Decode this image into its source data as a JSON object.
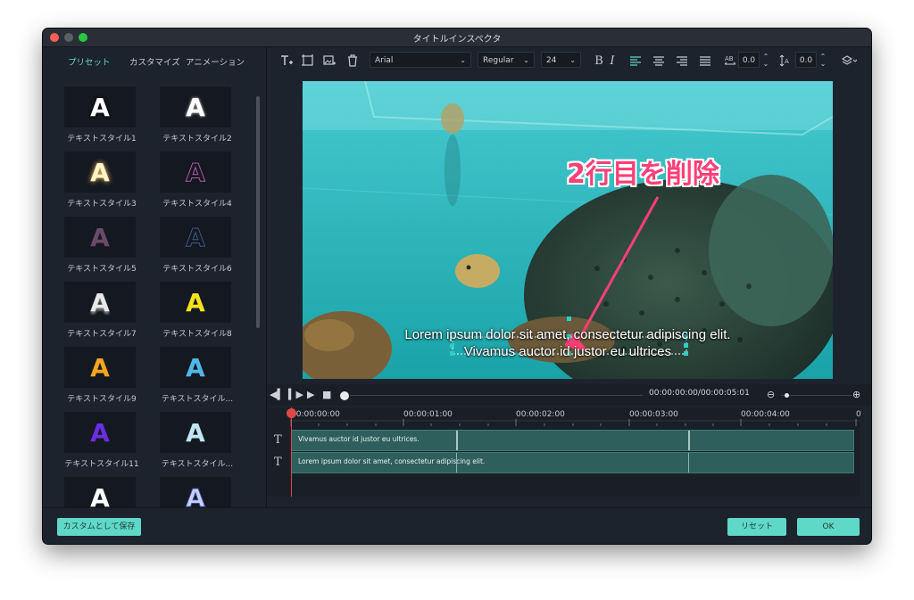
{
  "window": {
    "title": "タイトルインスペクタ"
  },
  "sidebar": {
    "tabs": [
      {
        "label": "プリセット",
        "active": true
      },
      {
        "label": "カスタマイズ",
        "active": false
      },
      {
        "label": "アニメーション",
        "active": false
      }
    ],
    "presets": [
      {
        "label": "テキストスタイル1",
        "glyph": "A",
        "color": "#ffffff"
      },
      {
        "label": "テキストスタイル2",
        "glyph": "A",
        "color": "#ffffff"
      },
      {
        "label": "テキストスタイル3",
        "glyph": "A",
        "color": "#fff3c8"
      },
      {
        "label": "テキストスタイル4",
        "glyph": "A",
        "color": "#b05aa8"
      },
      {
        "label": "テキストスタイル5",
        "glyph": "A",
        "color": "#6a4a6a"
      },
      {
        "label": "テキストスタイル6",
        "glyph": "A",
        "color": "#2a3f62"
      },
      {
        "label": "テキストスタイル7",
        "glyph": "A",
        "color": "#e8e8e8"
      },
      {
        "label": "テキストスタイル8",
        "glyph": "A",
        "color": "#f5e21c"
      },
      {
        "label": "テキストスタイル9",
        "glyph": "A",
        "color": "#f5a41e"
      },
      {
        "label": "テキストスタイル...",
        "glyph": "A",
        "color": "#4db8e8"
      },
      {
        "label": "テキストスタイル11",
        "glyph": "A",
        "color": "#6a2de0"
      },
      {
        "label": "テキストスタイル...",
        "glyph": "A",
        "color": "#bfe6f5"
      },
      {
        "label": "",
        "glyph": "A",
        "color": "#ffffff"
      },
      {
        "label": "",
        "glyph": "A",
        "color": "#c8d2f0"
      }
    ],
    "save_custom_label": "カスタムとして保存"
  },
  "toolbar": {
    "font": "Arial",
    "style": "Regular",
    "size": "24",
    "bold": "B",
    "italic": "I",
    "char_spacing": "0.0",
    "line_spacing": "0.0"
  },
  "preview": {
    "subtitle_line1": "Lorem ipsum dolor sit amet, consectetur adipiscing elit.",
    "subtitle_line2": "Vivamus auctor id justor eu ultrices",
    "annotation": "2行目を削除",
    "annotation_color": "#ff3f78"
  },
  "playback": {
    "timecode": "00:00:00:00/00:00:05:01"
  },
  "timeline": {
    "ruler": [
      "00:00:00:00",
      "00:00:01:00",
      "00:00:02:00",
      "00:00:03:00",
      "00:00:04:00",
      "0"
    ],
    "tracks": [
      {
        "text": "Vivamus auctor id justor eu ultrices."
      },
      {
        "text": "Lorem ipsum dolor sit amet, consectetur adipiscing elit."
      }
    ]
  },
  "footer": {
    "reset_label": "リセット",
    "ok_label": "OK"
  },
  "colors": {
    "accent": "#5fd8c7",
    "window_bg": "#1d232d",
    "track": "#2f5f5d",
    "playhead": "#e04848"
  }
}
